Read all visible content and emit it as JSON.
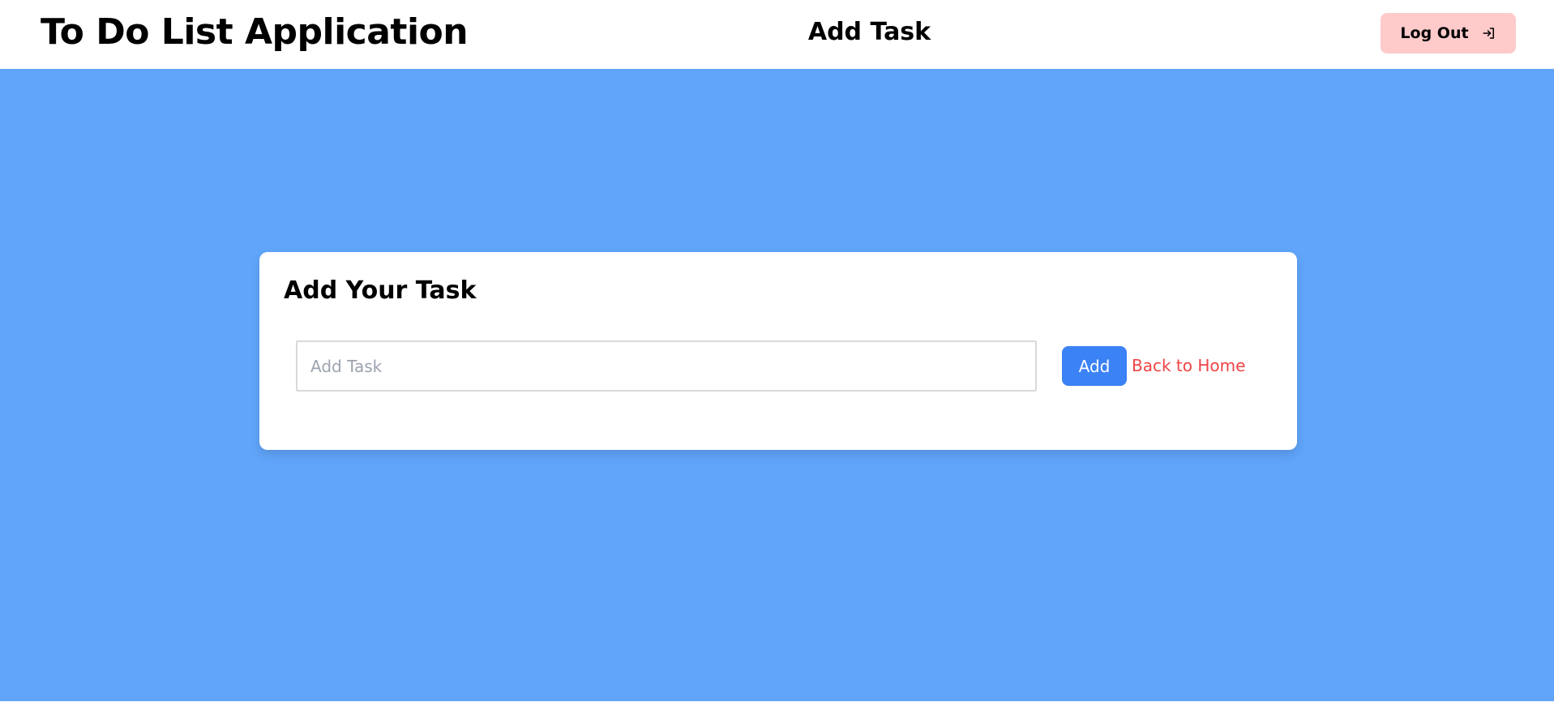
{
  "header": {
    "app_title": "To Do List Application",
    "page_heading": "Add Task",
    "logout_label": "Log Out",
    "logout_icon": "log-out-icon"
  },
  "card": {
    "title": "Add Your Task",
    "input_value": "",
    "input_placeholder": "Add Task",
    "add_label": "Add",
    "back_label": "Back to Home"
  },
  "colors": {
    "background": "#60a5fa",
    "header": "#ffffff",
    "logout_button": "#fecaca",
    "add_button": "#3b82f6",
    "back_link": "#ef4444"
  }
}
